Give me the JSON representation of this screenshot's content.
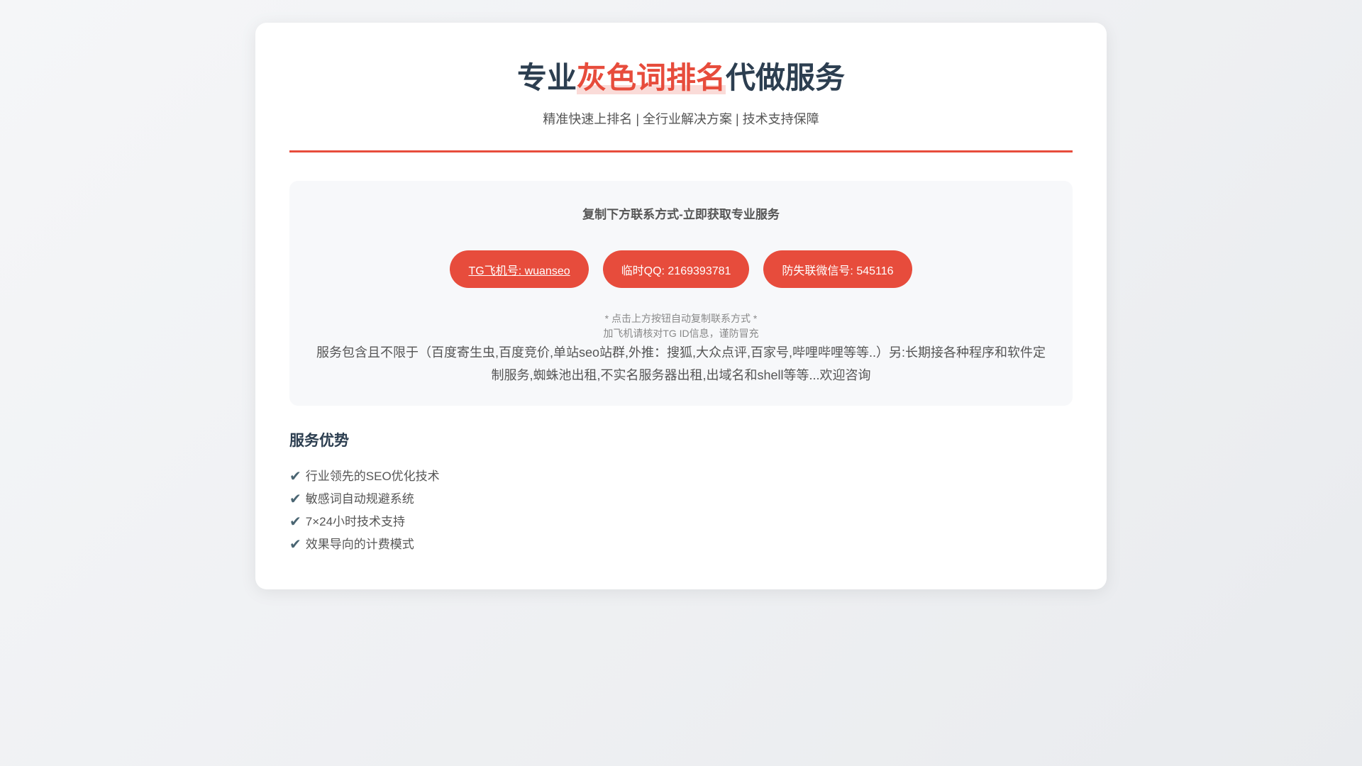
{
  "header": {
    "title_prefix": "专业",
    "title_highlight": "灰色词排名",
    "title_suffix": "代做服务",
    "subtitle": "精准快速上排名 | 全行业解决方案 | 技术支持保障"
  },
  "contact": {
    "heading": "复制下方联系方式-立即获取专业服务",
    "buttons": [
      {
        "label": "TG飞机号: wuanseo"
      },
      {
        "label": "临时QQ: 2169393781"
      },
      {
        "label": "防失联微信号: 545116"
      }
    ],
    "note1": "* 点击上方按钮自动复制联系方式 *",
    "note2": "加飞机请核对TG ID信息，谨防冒充",
    "description": "服务包含且不限于（百度寄生虫,百度竞价,单站seo站群,外推：搜狐,大众点评,百家号,哔哩哔哩等等..）另:长期接各种程序和软件定制服务,蜘蛛池出租,不实名服务器出租,出域名和shell等等...欢迎咨询"
  },
  "advantages": {
    "title": "服务优势",
    "check_icon": "✔",
    "items": [
      "行业领先的SEO优化技术",
      "敏感词自动规避系统",
      "7×24小时技术支持",
      "效果导向的计费模式"
    ]
  },
  "colors": {
    "accent": "#e74c3c",
    "heading": "#2c3e50"
  }
}
